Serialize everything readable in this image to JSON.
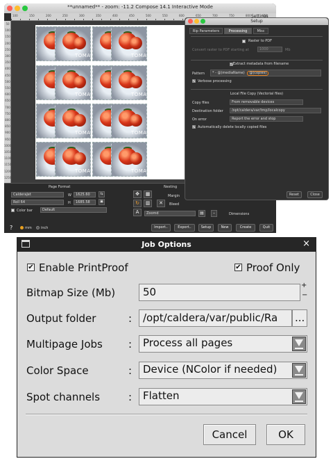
{
  "app": {
    "title": "**unnamed** - zoom: -11.2 Compose 14.1 Interactive Mode",
    "settings_label": "Settings",
    "ruler_top": [
      "100",
      "150",
      "200",
      "250",
      "300",
      "350",
      "400",
      "450",
      "500",
      "550",
      "600",
      "650",
      "700",
      "750",
      "800",
      "850"
    ],
    "ruler_left": [
      "50",
      "100",
      "150",
      "200",
      "250",
      "300",
      "350",
      "400",
      "450",
      "500",
      "550",
      "600",
      "650",
      "700",
      "750",
      "800",
      "850",
      "900",
      "950",
      "1000",
      "1050",
      "1100",
      "1150",
      "1200",
      "1250"
    ],
    "tile_text": "TOMAT",
    "page_format": {
      "title": "Page Format",
      "printer": "CalderaJet",
      "media": "Roll 64",
      "w_label": "W",
      "w_value": "1625.60",
      "h_label": "H",
      "h_value": "1685.58",
      "colorbar_label": "Color bar",
      "colorbar_value": "Default"
    },
    "nesting": {
      "title": "Nesting",
      "margin_label": "Margin",
      "bleed_label": "Bleed",
      "zoomed_value": "Zoomd"
    },
    "dimensions_label": "Dimensions",
    "help_icon": "?",
    "unit_mm": "mm",
    "unit_inch": "inch",
    "buttons": [
      "Import..",
      "Export..",
      "Setup",
      "New",
      "Create",
      "Quit"
    ]
  },
  "setup": {
    "title": "Setup",
    "tabs": [
      "Rip Parameters",
      "Processing",
      "Misc"
    ],
    "active_tab": "Processing",
    "raster_title": "Raster to PDF",
    "convert_label": "Convert raster to PDF starting at",
    "convert_value": "1000",
    "convert_unit": "Mb",
    "metadata_title": "Extract metadata from filename",
    "pattern_label": "Pattern",
    "pattern_value": "* - @(mediaName)",
    "pattern_highlight": "@(copies)",
    "verbose_label": "Verbose processing",
    "localcopy_title": "Local File Copy (Vectorial files)",
    "copy_files_label": "Copy files",
    "copy_files_value": "From removable devices",
    "dest_label": "Destination folder",
    "dest_value": "/opt/caldera/var/tmp/localcopy",
    "error_label": "On error",
    "error_value": "Report the error and stop",
    "autodelete_label": "Automatically delete locally copied files",
    "reset_label": "Reset",
    "close_label": "Close"
  },
  "job_options": {
    "title": "Job Options",
    "enable_printproof_label": "Enable PrintProof",
    "proof_only_label": "Proof Only",
    "bitmap_label": "Bitmap Size (Mb)",
    "bitmap_value": "50",
    "output_label": "Output folder",
    "output_value": "/opt/caldera/var/public/Ra",
    "browse_label": "...",
    "multipage_label": "Multipage Jobs",
    "multipage_value": "Process all pages",
    "colorspace_label": "Color Space",
    "colorspace_value": "Device (NColor if needed)",
    "spot_label": "Spot channels",
    "spot_value": "Flatten",
    "colon": ":",
    "cancel_label": "Cancel",
    "ok_label": "OK",
    "spin_up": "+",
    "spin_down": "−",
    "close_glyph": "×",
    "check_glyph": "✔"
  },
  "colors": {
    "accent_highlight": "#e8821e",
    "traffic_red": "#ff5f57",
    "traffic_yellow": "#febc2e",
    "traffic_green": "#28c840"
  }
}
